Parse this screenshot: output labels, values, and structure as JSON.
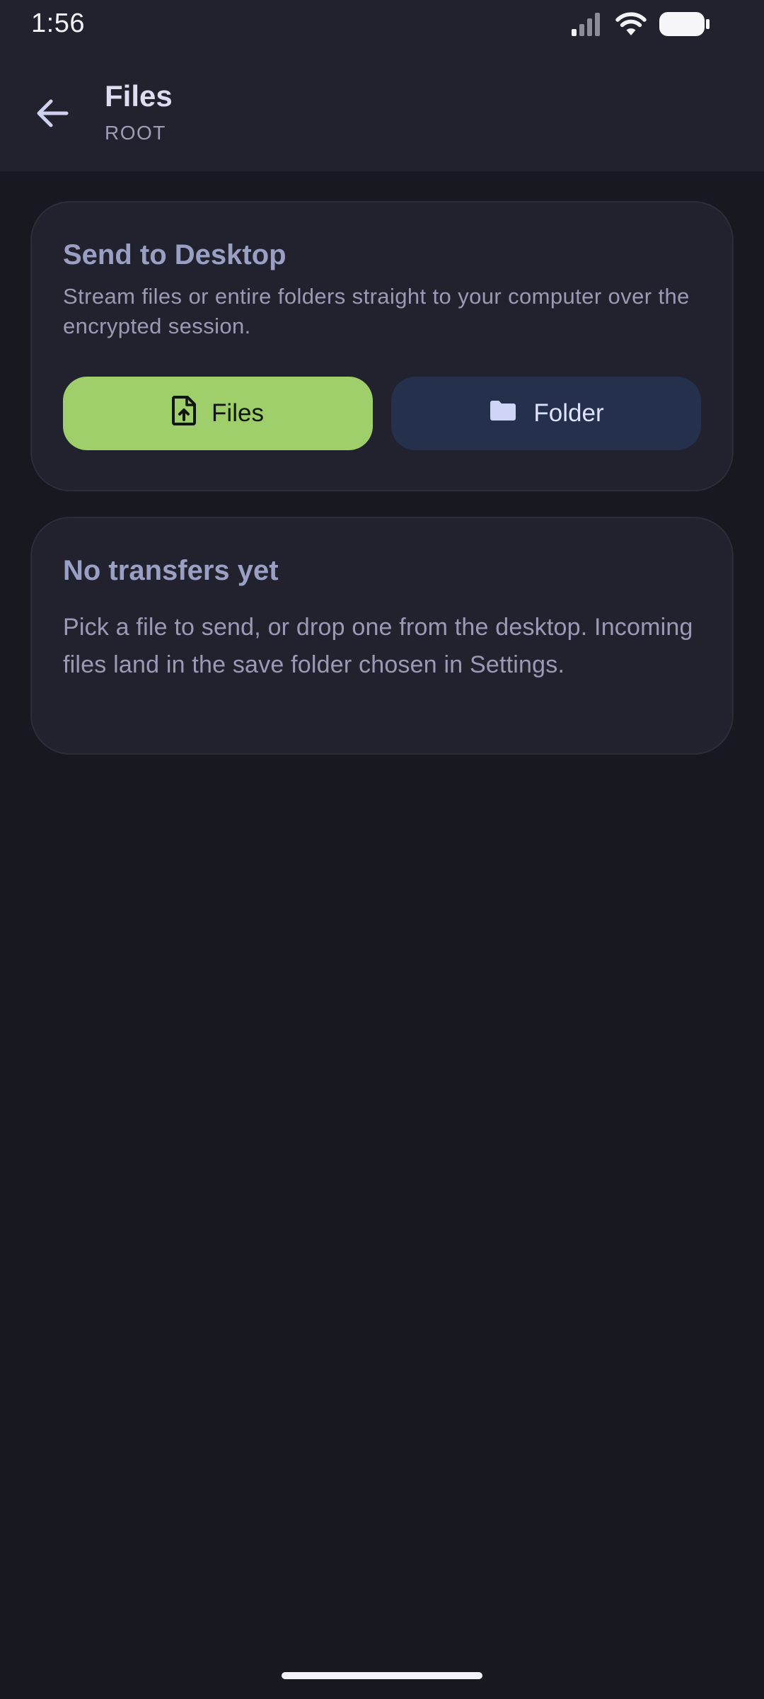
{
  "status_bar": {
    "time": "1:56",
    "icons": [
      "signal-icon",
      "wifi-icon",
      "battery-icon"
    ]
  },
  "app_bar": {
    "back_icon": "arrow-back-icon",
    "title": "Files",
    "subtitle": "ROOT"
  },
  "send_card": {
    "title": "Send to Desktop",
    "description": "Stream files or entire folders straight to your computer over the encrypted session.",
    "files_button": {
      "label": "Files",
      "icon": "file-upload-icon"
    },
    "folder_button": {
      "label": "Folder",
      "icon": "folder-icon"
    }
  },
  "empty_card": {
    "title": "No transfers yet",
    "description": "Pick a file to send, or drop one from the desktop. Incoming files land in the save folder chosen in Settings."
  },
  "colors": {
    "background": "#181821",
    "surface": "#22222e",
    "accent_green": "#9fcf6a",
    "folder_button": "#24304c",
    "title_text": "#dcdcf3",
    "muted_text": "#9a9ab6"
  }
}
